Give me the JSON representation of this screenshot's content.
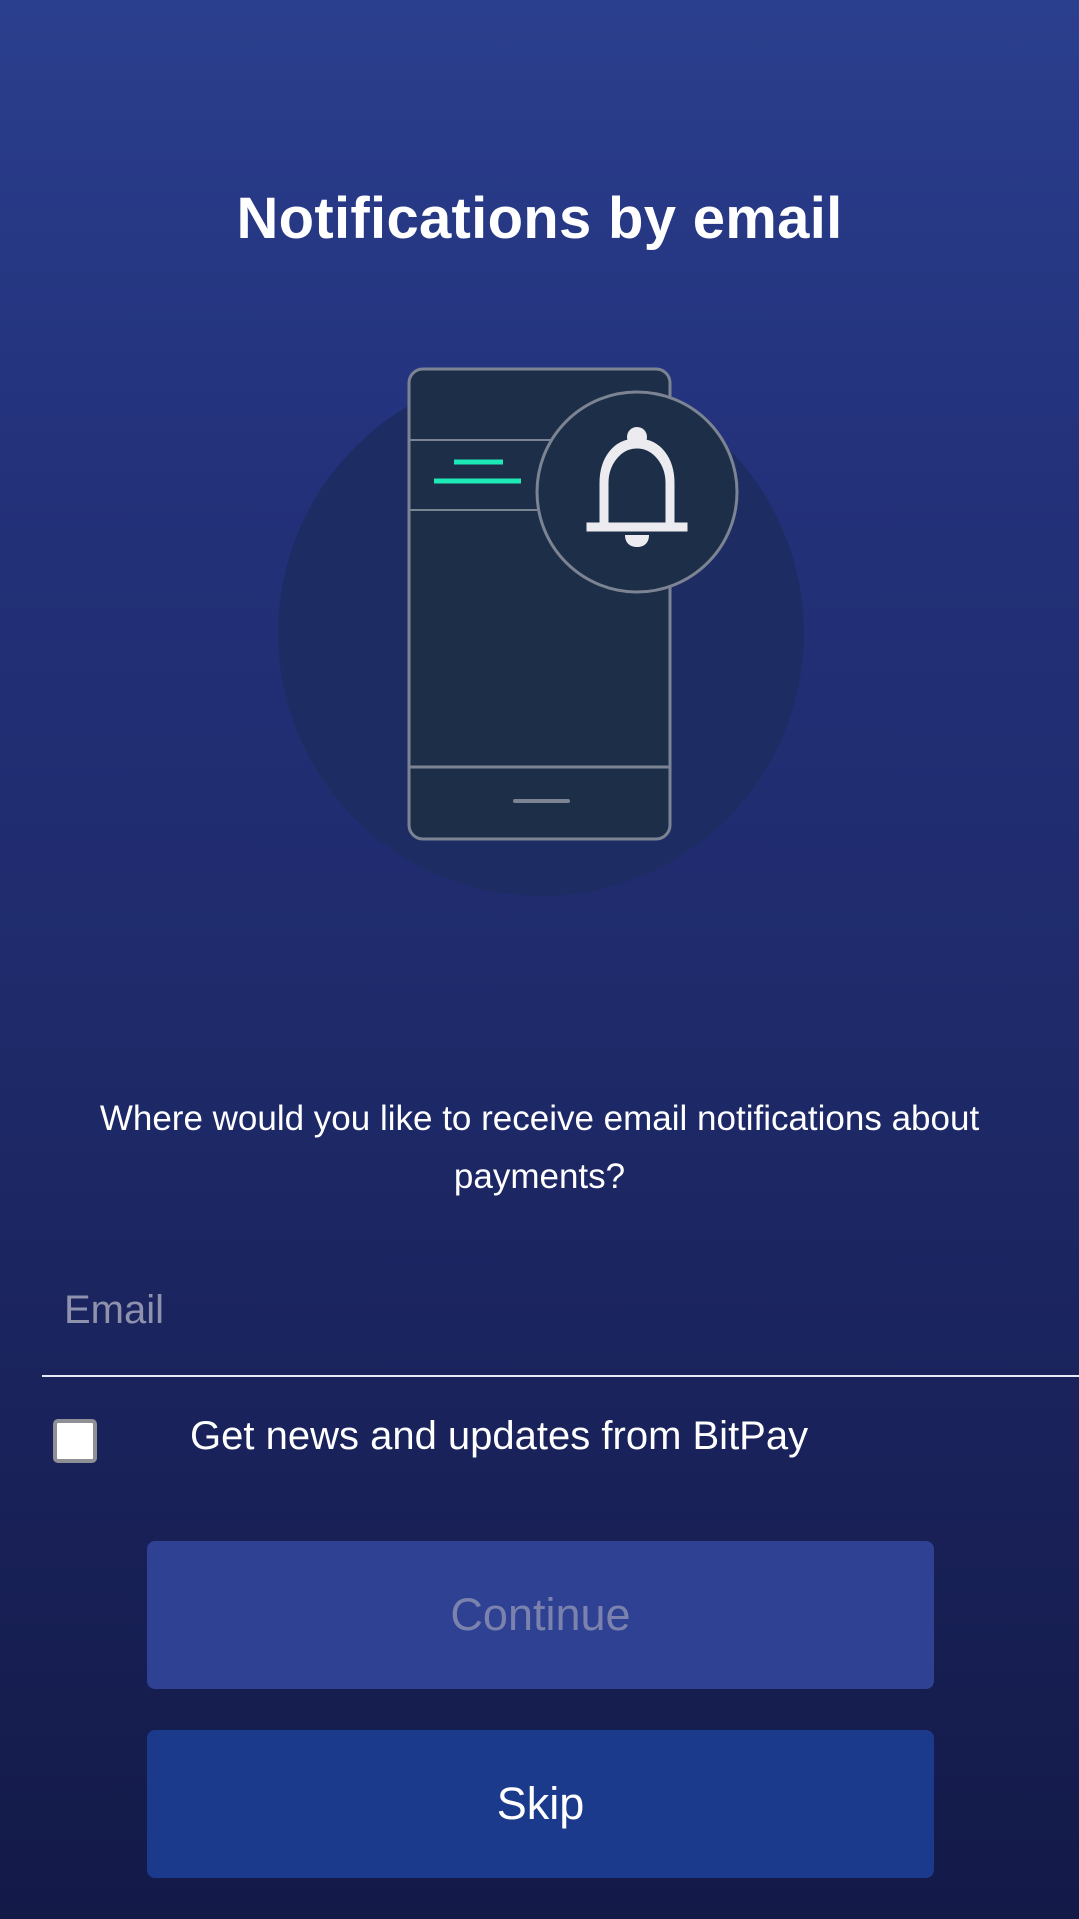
{
  "header": {
    "title": "Notifications by email"
  },
  "illustration": {
    "icon": "phone-bell-illustration",
    "accent_color": "#1de9b6"
  },
  "form": {
    "question": "Where would you like to receive email notifications about payments?",
    "email_placeholder": "Email",
    "email_value": "",
    "news_checkbox_label": "Get news and updates from BitPay",
    "news_checkbox_checked": false
  },
  "actions": {
    "continue_label": "Continue",
    "continue_enabled": false,
    "skip_label": "Skip"
  },
  "colors": {
    "background_top": "#2a3f8e",
    "background_bottom": "#131a48",
    "continue_button": "#2e4193",
    "skip_button": "#1b3a8c"
  }
}
